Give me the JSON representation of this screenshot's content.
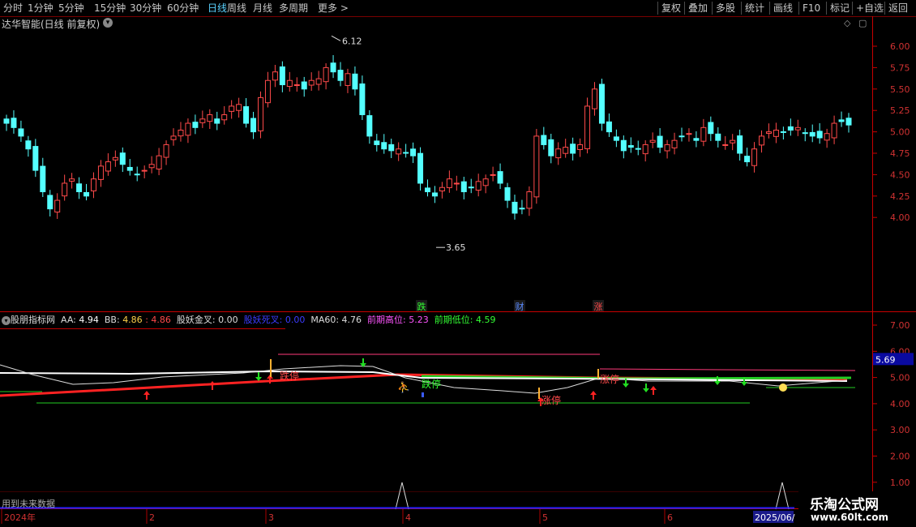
{
  "toolbar": {
    "left_items": [
      "分时",
      "1分钟",
      "5分钟",
      "15分钟",
      "30分钟",
      "60分钟",
      "日线",
      "周线",
      "月线",
      "多周期",
      "更多 >"
    ],
    "active": "日线",
    "right_items": [
      "复权",
      "叠加",
      "多股",
      "统计",
      "画线",
      "F10",
      "标记",
      "+自选",
      "返回"
    ]
  },
  "title": "达华智能(日线 前复权)",
  "main_axis_labels": [
    "6.00",
    "5.75",
    "5.50",
    "5.25",
    "5.00",
    "4.75",
    "4.50",
    "4.25",
    "4.00"
  ],
  "annotations": {
    "high_label": "6.12",
    "low_label": "3.65",
    "event_die": "跌",
    "event_cai": "财",
    "event_zhang": "涨"
  },
  "indicator": {
    "name": "股朋指标网",
    "aa_label": "AA:",
    "aa_value": "4.94",
    "bb_label": "BB:",
    "bb_value": "4.86",
    "extra_value": ": 4.86",
    "gold_label": "股妖金叉:",
    "gold_value": "0.00",
    "death_label": "股妖死叉:",
    "death_value": "0.00",
    "ma60_label": "MA60:",
    "ma60_value": "4.76",
    "high_label": "前期高位:",
    "high_value": "5.23",
    "low_label": "前期低位:",
    "low_value": "4.59"
  },
  "sub_axis_labels": [
    "7.00",
    "6.00",
    "5.00",
    "4.00",
    "3.00",
    "2.00",
    "1.00"
  ],
  "sub_axis_highlight": "5.69",
  "sub_chart_texts": [
    "跌停",
    "跌停",
    "涨停",
    "涨停"
  ],
  "future_note": "用到未来数据",
  "x_axis": {
    "labels": [
      "2024年",
      "2",
      "3",
      "4",
      "5",
      "6"
    ],
    "end_label": "2025/06/"
  },
  "watermark": {
    "line1": "乐淘公式网",
    "line2": "www.60lt.com"
  },
  "colors": {
    "up": "#ff4a4a",
    "down": "#54ffff",
    "ma": "#ffffff",
    "red_line": "#ff2222",
    "green_line": "#22cc22",
    "axis": "#c80000",
    "accent": "#5ad2ff"
  }
}
